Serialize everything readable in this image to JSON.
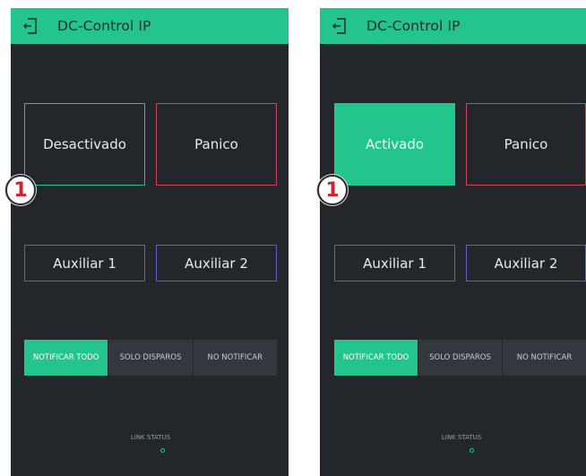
{
  "left": {
    "title": "DC-Control IP",
    "buttons": {
      "main": "Desactivado",
      "panic": "Panico",
      "aux1": "Auxiliar 1",
      "aux2": "Auxiliar 2"
    },
    "segments": [
      "NOTIFICAR TODO",
      "SOLO DISPAROS",
      "NO NOTIFICAR"
    ],
    "selected_segment": "NOTIFICAR TODO",
    "link_status": "LINK STATUS",
    "badge": "1"
  },
  "right": {
    "title": "DC-Control IP",
    "buttons": {
      "main": "Activado",
      "panic": "Panico",
      "aux1": "Auxiliar 1",
      "aux2": "Auxiliar 2"
    },
    "segments": [
      "NOTIFICAR TODO",
      "SOLO DISPAROS",
      "NO NOTIFICAR"
    ],
    "selected_segment": "NOTIFICAR TODO",
    "link_status": "LINK STATUS",
    "badge": "1"
  },
  "colors": {
    "accent": "#23c48e",
    "panic": "#d3435c",
    "aux": "#5b63c9",
    "background": "#23262b"
  }
}
